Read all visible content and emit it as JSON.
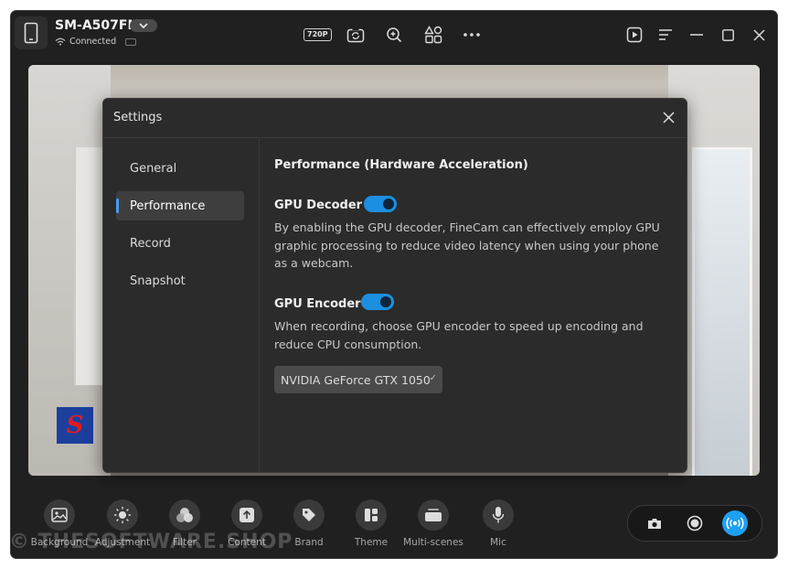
{
  "titlebar": {
    "device_name": "SM-A507FN",
    "connection_status": "Connected",
    "resolution_badge": "720P",
    "icons": [
      "phone-icon",
      "chevron-down-icon",
      "wifi-icon",
      "battery-icon",
      "resolution-icon",
      "rotate-camera-icon",
      "zoom-in-icon",
      "apps-icon",
      "more-icon",
      "play-icon",
      "menu-icon",
      "minimize-icon",
      "maximize-icon",
      "close-icon"
    ]
  },
  "dialog": {
    "title": "Settings",
    "nav": [
      "General",
      "Performance",
      "Record",
      "Snapshot"
    ],
    "active_nav": "Performance",
    "section_title": "Performance (Hardware Acceleration)",
    "gpu_decoder": {
      "label": "GPU Decoder",
      "enabled": true,
      "description": "By enabling the GPU decoder, FineCam can effectively employ GPU graphic processing to reduce video latency when using your phone as a webcam."
    },
    "gpu_encoder": {
      "label": "GPU Encoder",
      "enabled": true,
      "description": "When recording, choose GPU encoder to speed up encoding and reduce CPU consumption."
    },
    "encoder_select": "NVIDIA GeForce GTX 1050"
  },
  "toolbar": {
    "items": [
      {
        "label": "Background",
        "icon": "image-icon"
      },
      {
        "label": "Adjustment",
        "icon": "sun-icon"
      },
      {
        "label": "Filter",
        "icon": "filter-icon"
      },
      {
        "label": "Content",
        "icon": "upload-icon"
      },
      {
        "label": "Brand",
        "icon": "tag-icon"
      },
      {
        "label": "Theme",
        "icon": "layout-icon"
      },
      {
        "label": "Multi-scenes",
        "icon": "scenes-icon"
      },
      {
        "label": "Mic",
        "icon": "mic-icon"
      }
    ],
    "capture_icons": [
      "camera-icon",
      "record-icon",
      "live-icon"
    ]
  },
  "watermark": "© THESOFTWARE.SHOP",
  "colors": {
    "accent": "#1b8fe0",
    "window_bg": "#202020",
    "dialog_bg": "#2b2b2b"
  }
}
